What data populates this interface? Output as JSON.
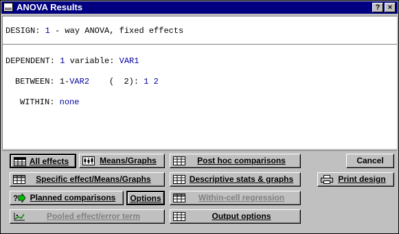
{
  "window": {
    "title": "ANOVA Results"
  },
  "titlebar": {
    "help_label": "?",
    "close_label": "×"
  },
  "design": {
    "label": "DESIGN:",
    "count": "1",
    "text": "- way ANOVA, fixed effects"
  },
  "dependent": {
    "label": "DEPENDENT:",
    "count": "1",
    "text": "variable:",
    "var": "VAR1"
  },
  "between": {
    "label": "BETWEEN:",
    "prefix": "1-",
    "var": "VAR2",
    "open": "(",
    "levels": "2):",
    "values": "1 2"
  },
  "within": {
    "label": "WITHIN:",
    "value": "none"
  },
  "buttons": {
    "all_effects": "All effects",
    "means_graphs": "Means/Graphs",
    "post_hoc": "Post hoc comparisons",
    "cancel": "Cancel",
    "specific": "Specific effect/Means/Graphs",
    "descriptive": "Descriptive stats & graphs",
    "print_design": "Print design",
    "planned": "Planned comparisons",
    "options": "Options",
    "within_cell": "Within-cell regression",
    "pooled": "Pooled effect/error term",
    "output_options": "Output options"
  },
  "icons": {
    "sysmenu": "window-menu-icon",
    "all_effects": "table-icon",
    "means": "means-plot-icon",
    "post_hoc": "spreadsheet-icon",
    "specific": "grid-icon",
    "descriptive": "spreadsheet-icon",
    "print": "printer-icon",
    "planned": "question-arrow-icon",
    "within_cell": "grid-icon",
    "pooled": "regression-icon",
    "output": "spreadsheet-icon"
  },
  "colors": {
    "titlebar": "#000080",
    "value_text": "#0000a0",
    "disabled": "#808080"
  }
}
